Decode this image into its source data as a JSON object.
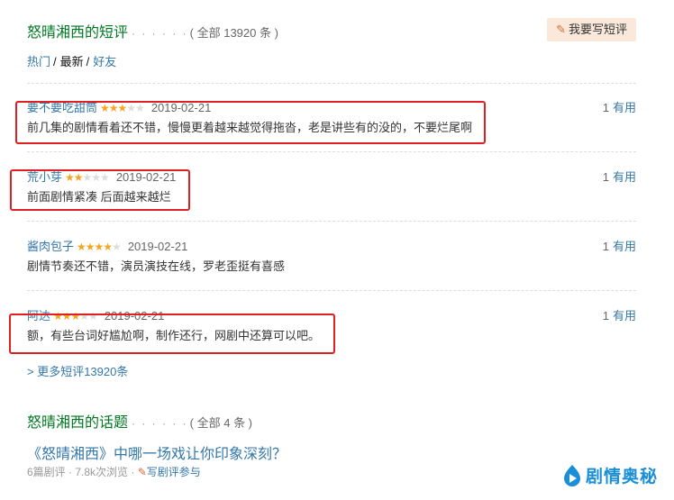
{
  "reviews_section": {
    "title": "怒晴湘西的短评",
    "dots": "· · · · · ·",
    "count": "( 全部 13920 条 )",
    "write_button": "我要写短评"
  },
  "tabs": {
    "hot": "热门",
    "latest": "最新",
    "friends": "好友",
    "sep": "/"
  },
  "comments": [
    {
      "user": "要不要吃甜筒",
      "stars": 3,
      "date": "2019-02-21",
      "text": "前几集的剧情看着还不错，慢慢更着越来越觉得拖沓，老是讲些有的没的，不要烂尾啊",
      "useful_count": "1",
      "useful_label": "有用"
    },
    {
      "user": "荒小芽",
      "stars": 2,
      "date": "2019-02-21",
      "text": "前面剧情紧凑 后面越来越烂",
      "useful_count": "1",
      "useful_label": "有用"
    },
    {
      "user": "酱肉包子",
      "stars": 4,
      "date": "2019-02-21",
      "text": "剧情节奏还不错，演员演技在线，罗老歪挺有喜感",
      "useful_count": "1",
      "useful_label": "有用"
    },
    {
      "user": "阿达",
      "stars": 3,
      "date": "2019-02-21",
      "text": "额，有些台词好尴尬啊，制作还行，网剧中还算可以吧。",
      "useful_count": "1",
      "useful_label": "有用"
    }
  ],
  "more_link": "> 更多短评13920条",
  "topics_section": {
    "title": "怒晴湘西的话题",
    "dots": "· · · · · ·",
    "count": "( 全部 4 条 )",
    "topic_title": "《怒晴湘西》中哪一场戏让你印象深刻？",
    "meta": "6篇剧评 · 7.8k次浏览 · ",
    "write_label": "写剧评参与"
  },
  "watermark": {
    "text": "剧情奥秘"
  },
  "colors": {
    "green_title": "#007722",
    "link_blue": "#3377aa",
    "star_gold": "#f4a622",
    "highlight_red": "#e02020"
  }
}
